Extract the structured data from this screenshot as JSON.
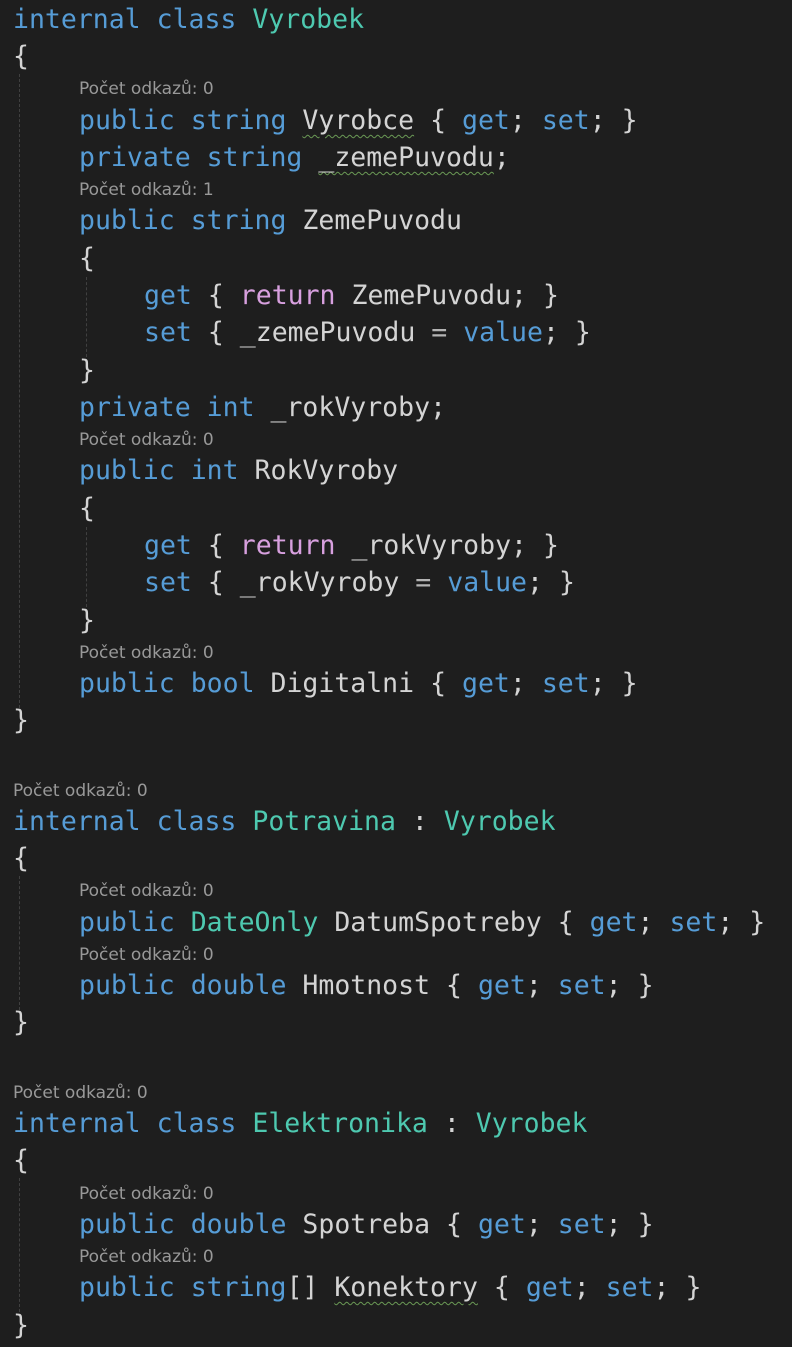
{
  "editor": {
    "tokens": {
      "internal": "internal",
      "class": "class",
      "public": "public",
      "private": "private",
      "string": "string",
      "int": "int",
      "bool": "bool",
      "double": "double",
      "get": "get",
      "set": "set",
      "return": "return",
      "value": "value",
      "open_brace": "{",
      "close_brace": "}",
      "colon": ":",
      "semicolon": ";",
      "equals": "=",
      "array_brackets": "[]"
    },
    "type_names": {
      "Vyrobek": "Vyrobek",
      "Potravina": "Potravina",
      "Elektronika": "Elektronika",
      "DateOnly": "DateOnly"
    },
    "identifiers": {
      "Vyrobce": "Vyrobce",
      "_zemePuvodu": "_zemePuvodu",
      "ZemePuvodu": "ZemePuvodu",
      "_rokVyroby": "_rokVyroby",
      "RokVyroby": "RokVyroby",
      "Digitalni": "Digitalni",
      "DatumSpotreby": "DatumSpotreby",
      "Hmotnost": "Hmotnost",
      "Spotreba": "Spotreba",
      "Konektory": "Konektory"
    },
    "code_lens": {
      "refs_0": "Počet odkazů: 0",
      "refs_1": "Počet odkazů: 1"
    }
  },
  "colors": {
    "background": "#1e1e1e",
    "keyword": "#569cd6",
    "control_keyword": "#d8a0df",
    "type": "#4ec9b0",
    "text": "#d4d4d4",
    "code_lens": "#999999",
    "squiggle": "#6a9955"
  }
}
